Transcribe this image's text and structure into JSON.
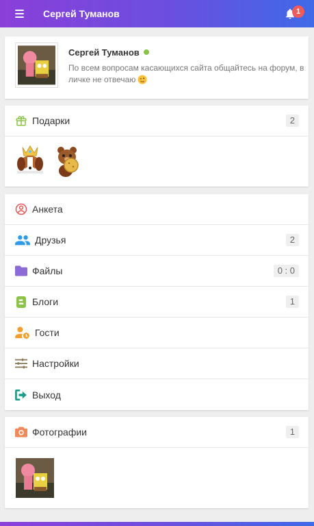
{
  "header": {
    "title": "Сергей Туманов",
    "notifications_count": "1",
    "gradient_colors": [
      "#8b3fd9",
      "#3f6ae8"
    ]
  },
  "profile": {
    "name": "Сергей Туманов",
    "status_text": "По всем вопросам касающихся сайта общайтесь на форум, в личке не отвечаю",
    "online": true,
    "online_color": "#8bc34a"
  },
  "gifts": {
    "label": "Подарки",
    "count": "2",
    "icon": "gift-icon",
    "icon_color": "#8bc34a"
  },
  "menu": {
    "items": [
      {
        "label": "Анкета",
        "icon": "user-circle-icon",
        "color": "#e05a5a",
        "count": ""
      },
      {
        "label": "Друзья",
        "icon": "friends-icon",
        "color": "#2f9be8",
        "count": "2"
      },
      {
        "label": "Файлы",
        "icon": "folder-icon",
        "color": "#8c6bd6",
        "count": "0 : 0"
      },
      {
        "label": "Блоги",
        "icon": "blog-icon",
        "color": "#8bc34a",
        "count": "1"
      },
      {
        "label": "Гости",
        "icon": "guests-icon",
        "color": "#f0a030",
        "count": ""
      },
      {
        "label": "Настройки",
        "icon": "sliders-icon",
        "color": "#8a7a5a",
        "count": ""
      },
      {
        "label": "Выход",
        "icon": "logout-icon",
        "color": "#1a9a8a",
        "count": ""
      }
    ]
  },
  "photos": {
    "label": "Фотографии",
    "count": "1",
    "icon": "camera-icon",
    "icon_color": "#f08a5a"
  }
}
